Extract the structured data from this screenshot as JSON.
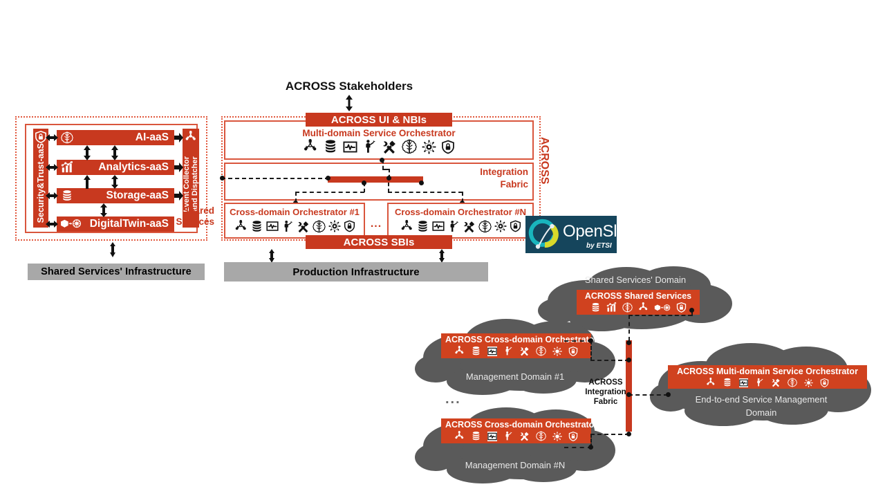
{
  "diagram": {
    "stakeholders_label": "ACROSS Stakeholders",
    "across_vertical_label": "ACROSS",
    "shared_services_label_line1": "Shared",
    "shared_services_label_line2": "Services",
    "security_trust_label": "Security&Trust-aaS",
    "event_collector_line1": "Event Collector",
    "event_collector_line2": "and Dispatcher",
    "integration_fabric_line1": "Integration",
    "integration_fabric_line2": "Fabric",
    "ui_nbis_label": "ACROSS UI & NBIs",
    "sbis_label": "ACROSS SBIs",
    "mdso_label": "Multi-domain Service Orchestrator",
    "cdo1_label": "Cross-domain Orchestrator #1",
    "cdoN_label": "Cross-domain Orchestrator #N",
    "ellipsis": "...",
    "shared_aas": [
      {
        "name": "AI-aaS",
        "icon": "brain-icon"
      },
      {
        "name": "Analytics-aaS",
        "icon": "bar-chart-icon"
      },
      {
        "name": "Storage-aaS",
        "icon": "database-icon"
      },
      {
        "name": "DigitalTwin-aaS",
        "icon": "digital-twin-icon"
      }
    ],
    "infrastructure": {
      "shared": "Shared Services' Infrastructure",
      "production": "Production Infrastructure"
    },
    "orchestrator_icons": [
      "node-orchestration-icon",
      "database-icon",
      "monitoring-icon",
      "operator-person-icon",
      "tools-icon",
      "brain-icon",
      "gear-ai-icon",
      "shield-lock-icon"
    ],
    "shared_services_icons": [
      "database-icon",
      "bar-chart-icon",
      "brain-icon",
      "node-orchestration-icon",
      "digital-twin-icon",
      "shield-lock-icon"
    ]
  },
  "openslice": {
    "name": "OpenSlice",
    "byline": "by ETSI"
  },
  "domains": {
    "shared_services_domain": {
      "title": "Shared Services' Domain",
      "band_title": "ACROSS Shared Services"
    },
    "management_domain_1": {
      "title": "Management Domain #1",
      "band_title": "ACROSS Cross-domain Orchestrator"
    },
    "management_domain_n": {
      "title": "Management Domain #N",
      "band_title": "ACROSS Cross-domain Orchestrator"
    },
    "e2e_domain": {
      "title_line1": "End-to-end Service Management",
      "title_line2": "Domain",
      "band_title": "ACROSS Multi-domain Service Orchestrator"
    },
    "integration_fabric": {
      "line1": "ACROSS",
      "line2": "Integration",
      "line3": "Fabric"
    },
    "ellipsis": "..."
  },
  "colors": {
    "accent_red": "#c8391f",
    "accent_red_light": "#d9553c",
    "cloud_gray": "#5a5a5a",
    "infra_gray": "#a8a8a8",
    "openslice_bg": "#15455c",
    "openslice_cyan": "#19b5bd",
    "openslice_yellow": "#d8d92a"
  }
}
